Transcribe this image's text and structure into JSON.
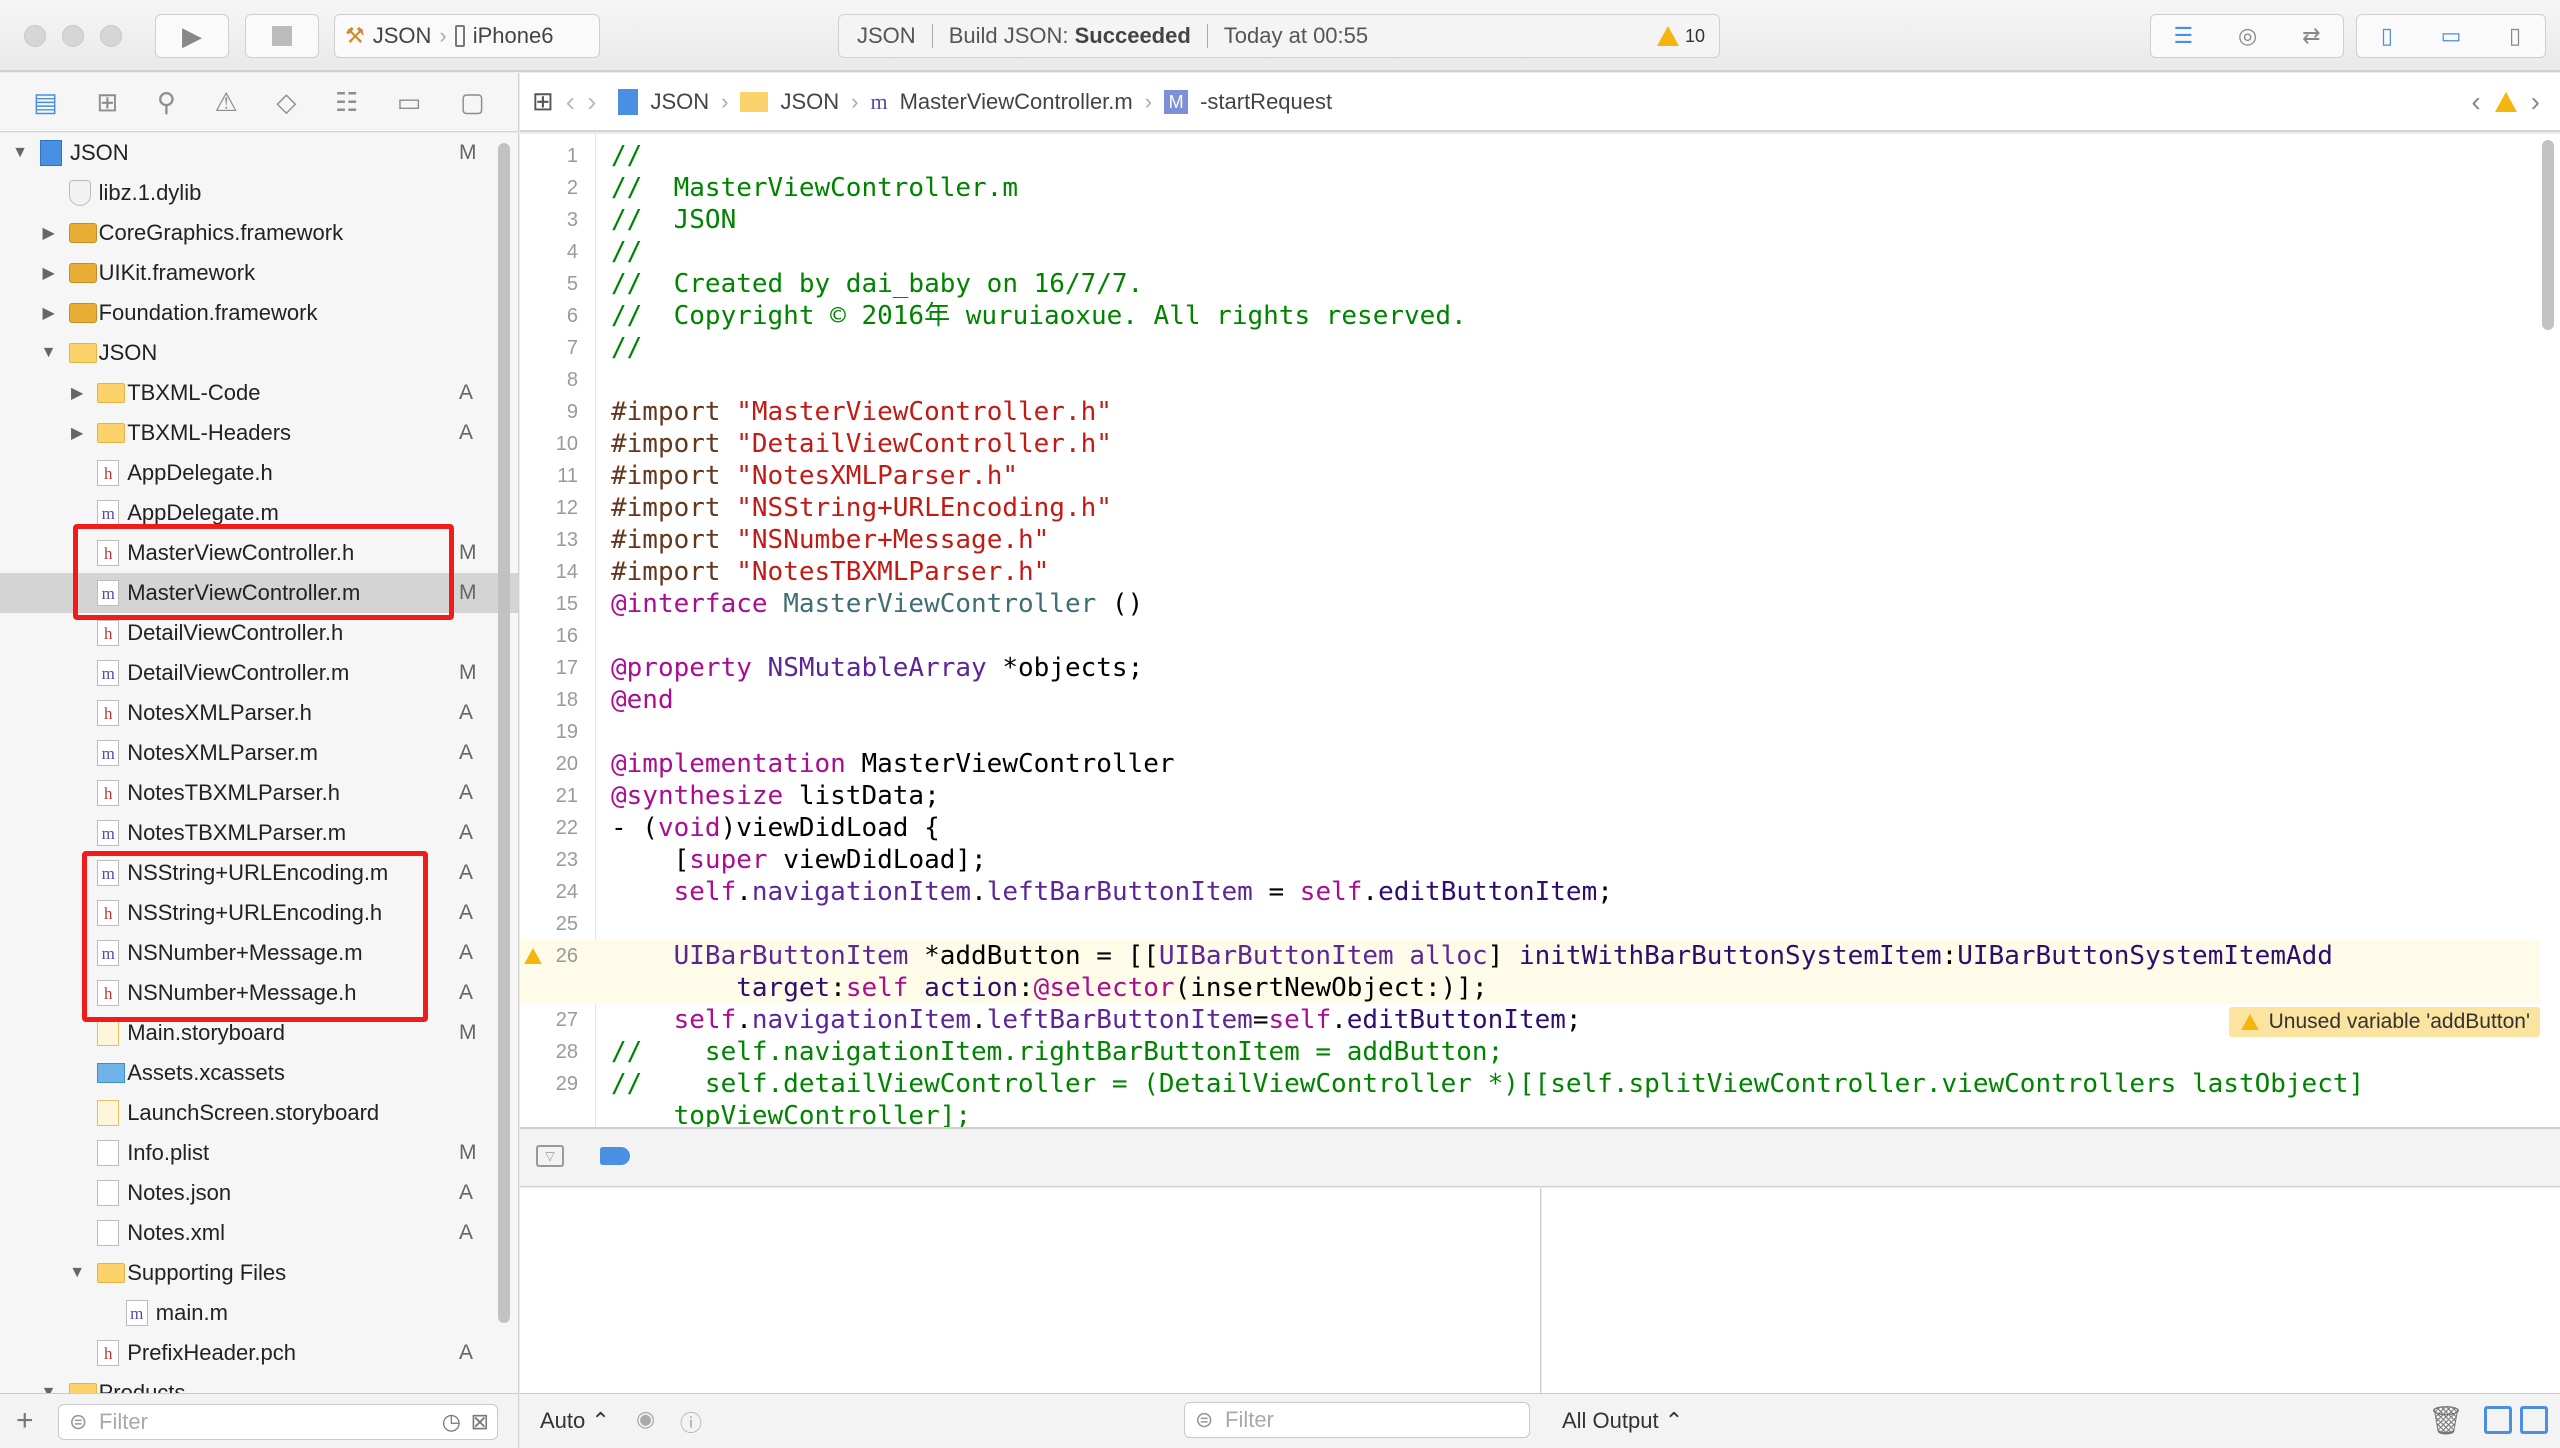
{
  "toolbar": {
    "scheme": "JSON",
    "device": "iPhone6",
    "activity_project": "JSON",
    "activity_status_prefix": "Build JSON: ",
    "activity_status": "Succeeded",
    "activity_time": "Today at 00:55",
    "warning_count": "10"
  },
  "jumpbar": {
    "items": [
      "JSON",
      "JSON",
      "MasterViewController.m",
      "-startRequest"
    ]
  },
  "sidebar": {
    "filter_placeholder": "Filter",
    "items": [
      {
        "level": 0,
        "disc": "open",
        "icon": "proj",
        "label": "JSON",
        "badge": "M"
      },
      {
        "level": 1,
        "disc": "",
        "icon": "dylib",
        "label": "libz.1.dylib",
        "badge": ""
      },
      {
        "level": 1,
        "disc": "closed",
        "icon": "framework",
        "label": "CoreGraphics.framework",
        "badge": ""
      },
      {
        "level": 1,
        "disc": "closed",
        "icon": "framework",
        "label": "UIKit.framework",
        "badge": ""
      },
      {
        "level": 1,
        "disc": "closed",
        "icon": "framework",
        "label": "Foundation.framework",
        "badge": ""
      },
      {
        "level": 1,
        "disc": "open",
        "icon": "folder",
        "label": "JSON",
        "badge": ""
      },
      {
        "level": 2,
        "disc": "closed",
        "icon": "folder",
        "label": "TBXML-Code",
        "badge": "A"
      },
      {
        "level": 2,
        "disc": "closed",
        "icon": "folder",
        "label": "TBXML-Headers",
        "badge": "A"
      },
      {
        "level": 2,
        "disc": "",
        "icon": "h",
        "label": "AppDelegate.h",
        "badge": ""
      },
      {
        "level": 2,
        "disc": "",
        "icon": "m",
        "label": "AppDelegate.m",
        "badge": ""
      },
      {
        "level": 2,
        "disc": "",
        "icon": "h",
        "label": "MasterViewController.h",
        "badge": "M"
      },
      {
        "level": 2,
        "disc": "",
        "icon": "m",
        "label": "MasterViewController.m",
        "badge": "M",
        "selected": true
      },
      {
        "level": 2,
        "disc": "",
        "icon": "h",
        "label": "DetailViewController.h",
        "badge": ""
      },
      {
        "level": 2,
        "disc": "",
        "icon": "m",
        "label": "DetailViewController.m",
        "badge": "M"
      },
      {
        "level": 2,
        "disc": "",
        "icon": "h",
        "label": "NotesXMLParser.h",
        "badge": "A"
      },
      {
        "level": 2,
        "disc": "",
        "icon": "m",
        "label": "NotesXMLParser.m",
        "badge": "A"
      },
      {
        "level": 2,
        "disc": "",
        "icon": "h",
        "label": "NotesTBXMLParser.h",
        "badge": "A"
      },
      {
        "level": 2,
        "disc": "",
        "icon": "m",
        "label": "NotesTBXMLParser.m",
        "badge": "A"
      },
      {
        "level": 2,
        "disc": "",
        "icon": "m",
        "label": "NSString+URLEncoding.m",
        "badge": "A"
      },
      {
        "level": 2,
        "disc": "",
        "icon": "h",
        "label": "NSString+URLEncoding.h",
        "badge": "A"
      },
      {
        "level": 2,
        "disc": "",
        "icon": "m",
        "label": "NSNumber+Message.m",
        "badge": "A"
      },
      {
        "level": 2,
        "disc": "",
        "icon": "h",
        "label": "NSNumber+Message.h",
        "badge": "A"
      },
      {
        "level": 2,
        "disc": "",
        "icon": "storyboard",
        "label": "Main.storyboard",
        "badge": "M"
      },
      {
        "level": 2,
        "disc": "",
        "icon": "assets",
        "label": "Assets.xcassets",
        "badge": ""
      },
      {
        "level": 2,
        "disc": "",
        "icon": "storyboard",
        "label": "LaunchScreen.storyboard",
        "badge": ""
      },
      {
        "level": 2,
        "disc": "",
        "icon": "plist",
        "label": "Info.plist",
        "badge": "M"
      },
      {
        "level": 2,
        "disc": "",
        "icon": "plist",
        "label": "Notes.json",
        "badge": "A"
      },
      {
        "level": 2,
        "disc": "",
        "icon": "plist",
        "label": "Notes.xml",
        "badge": "A"
      },
      {
        "level": 2,
        "disc": "open",
        "icon": "folder",
        "label": "Supporting Files",
        "badge": ""
      },
      {
        "level": 3,
        "disc": "",
        "icon": "m",
        "label": "main.m",
        "badge": ""
      },
      {
        "level": 2,
        "disc": "",
        "icon": "h",
        "label": "PrefixHeader.pch",
        "badge": "A"
      },
      {
        "level": 1,
        "disc": "open",
        "icon": "folder",
        "label": "Products",
        "badge": ""
      }
    ]
  },
  "editor": {
    "issue": "Unused variable 'addButton'",
    "warning_line": "26",
    "lines": [
      {
        "n": "1",
        "t": [
          [
            "//",
            "c"
          ]
        ]
      },
      {
        "n": "2",
        "t": [
          [
            "//  MasterViewController.m",
            "c"
          ]
        ]
      },
      {
        "n": "3",
        "t": [
          [
            "//  JSON",
            "c"
          ]
        ]
      },
      {
        "n": "4",
        "t": [
          [
            "//",
            "c"
          ]
        ]
      },
      {
        "n": "5",
        "t": [
          [
            "//  Created by dai_baby on 16/7/7.",
            "c"
          ]
        ]
      },
      {
        "n": "6",
        "t": [
          [
            "//  Copyright © 2016年 wuruiaoxue. All rights reserved.",
            "c"
          ]
        ]
      },
      {
        "n": "7",
        "t": [
          [
            "//",
            "c"
          ]
        ]
      },
      {
        "n": "8",
        "t": []
      },
      {
        "n": "9",
        "t": [
          [
            "#import ",
            "p"
          ],
          [
            "\"MasterViewController.h\"",
            "s"
          ]
        ]
      },
      {
        "n": "10",
        "t": [
          [
            "#import ",
            "p"
          ],
          [
            "\"DetailViewController.h\"",
            "s"
          ]
        ]
      },
      {
        "n": "11",
        "t": [
          [
            "#import ",
            "p"
          ],
          [
            "\"NotesXMLParser.h\"",
            "s"
          ]
        ]
      },
      {
        "n": "12",
        "t": [
          [
            "#import ",
            "p"
          ],
          [
            "\"NSString+URLEncoding.h\"",
            "s"
          ]
        ]
      },
      {
        "n": "13",
        "t": [
          [
            "#import ",
            "p"
          ],
          [
            "\"NSNumber+Message.h\"",
            "s"
          ]
        ]
      },
      {
        "n": "14",
        "t": [
          [
            "#import ",
            "p"
          ],
          [
            "\"NotesTBXMLParser.h\"",
            "s"
          ]
        ]
      },
      {
        "n": "15",
        "t": [
          [
            "@interface ",
            "k"
          ],
          [
            "MasterViewController",
            "u"
          ],
          [
            " ()",
            ""
          ]
        ]
      },
      {
        "n": "16",
        "t": []
      },
      {
        "n": "17",
        "t": [
          [
            "@property ",
            "k"
          ],
          [
            "NSMutableArray",
            "t"
          ],
          [
            " *objects;",
            ""
          ]
        ]
      },
      {
        "n": "18",
        "t": [
          [
            "@end",
            "k"
          ]
        ]
      },
      {
        "n": "19",
        "t": []
      },
      {
        "n": "20",
        "t": [
          [
            "@implementation ",
            "k"
          ],
          [
            "MasterViewController",
            ""
          ]
        ]
      },
      {
        "n": "21",
        "t": [
          [
            "@synthesize ",
            "k"
          ],
          [
            "listData;",
            ""
          ]
        ]
      },
      {
        "n": "22",
        "t": [
          [
            "- (",
            "",
            ""
          ],
          [
            "void",
            "k"
          ],
          [
            ")viewDidLoad {",
            ""
          ]
        ]
      },
      {
        "n": "23",
        "t": [
          [
            "    [",
            "",
            ""
          ],
          [
            "super",
            "k"
          ],
          [
            " viewDidLoad];",
            ""
          ]
        ]
      },
      {
        "n": "24",
        "t": [
          [
            "    ",
            ""
          ],
          [
            "self",
            "k"
          ],
          [
            ".",
            "",
            ""
          ],
          [
            "navigationItem",
            "t"
          ],
          [
            ".",
            ""
          ],
          [
            "leftBarButtonItem",
            "t"
          ],
          [
            " = ",
            ""
          ],
          [
            "self",
            "k"
          ],
          [
            ".",
            ""
          ],
          [
            "editButtonItem",
            "m"
          ],
          [
            ";",
            ""
          ]
        ]
      },
      {
        "n": "25",
        "t": []
      },
      {
        "n": "26",
        "hl": true,
        "t": [
          [
            "    ",
            ""
          ],
          [
            "UIBarButtonItem",
            "t"
          ],
          [
            " *addButton = [[",
            ""
          ],
          [
            "UIBarButtonItem",
            "t"
          ],
          [
            " ",
            ""
          ],
          [
            "alloc",
            "t"
          ],
          [
            "] ",
            ""
          ],
          [
            "initWithBarButtonSystemItem",
            "m"
          ],
          [
            ":",
            ""
          ],
          [
            "UIBarButtonSystemItemAdd",
            "m"
          ]
        ]
      },
      {
        "n": "",
        "hl": true,
        "t": [
          [
            "        ",
            ""
          ],
          [
            "target",
            "m"
          ],
          [
            ":",
            ""
          ],
          [
            "self",
            "k"
          ],
          [
            " ",
            ""
          ],
          [
            "action",
            "m"
          ],
          [
            ":",
            ""
          ],
          [
            "@selector",
            "k"
          ],
          [
            "(insertNewObject:)];",
            ""
          ]
        ]
      },
      {
        "n": "27",
        "t": [
          [
            "    ",
            ""
          ],
          [
            "self",
            "k"
          ],
          [
            ".",
            ""
          ],
          [
            "navigationItem",
            "t"
          ],
          [
            ".",
            ""
          ],
          [
            "leftBarButtonItem",
            "t"
          ],
          [
            "=",
            ""
          ],
          [
            "self",
            "k"
          ],
          [
            ".",
            ""
          ],
          [
            "editButtonItem",
            "m"
          ],
          [
            ";",
            ""
          ]
        ]
      },
      {
        "n": "28",
        "t": [
          [
            "//    self.navigationItem.rightBarButtonItem = addButton;",
            "c"
          ]
        ]
      },
      {
        "n": "29",
        "t": [
          [
            "//    self.detailViewController = (DetailViewController *)[[self.splitViewController.viewControllers lastObject]",
            "c"
          ]
        ]
      },
      {
        "n": "",
        "t": [
          [
            "    topViewController];",
            "c"
          ]
        ]
      }
    ]
  },
  "debug": {
    "auto_label": "Auto ⌃",
    "filter_placeholder": "Filter",
    "output_label": "All Output ⌃"
  },
  "colors": {
    "selection": "#d4d4d4",
    "highlight_box": "#f01b1b",
    "warning": "#f6b40e",
    "accent": "#4a90e2"
  }
}
